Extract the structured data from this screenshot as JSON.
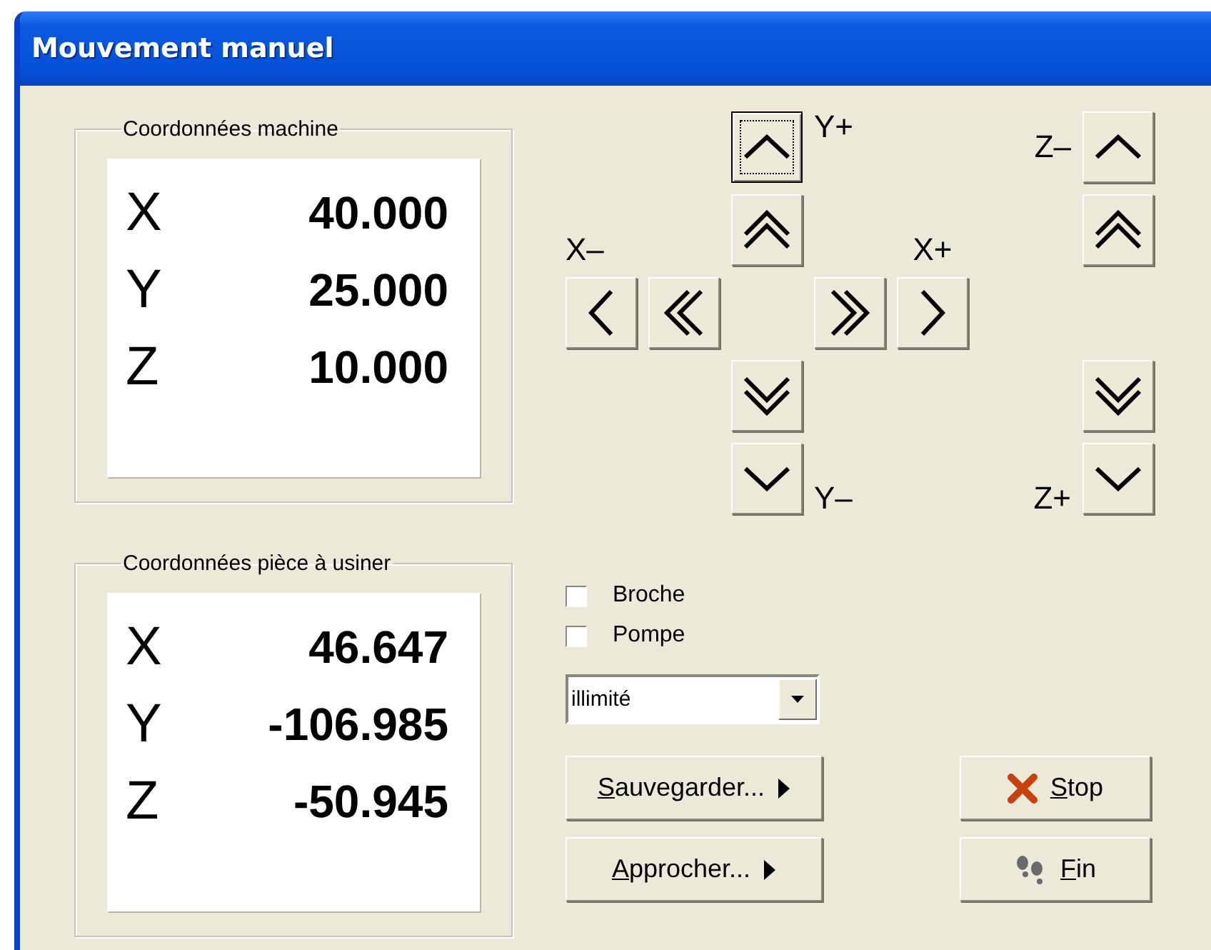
{
  "window": {
    "title": "Mouvement manuel"
  },
  "coordinate_groups": [
    {
      "label": "Coordonnées machine",
      "rows": [
        {
          "axis": "X",
          "value": "40.000"
        },
        {
          "axis": "Y",
          "value": "25.000"
        },
        {
          "axis": "Z",
          "value": "10.000"
        }
      ]
    },
    {
      "label": "Coordonnées pièce à usiner",
      "rows": [
        {
          "axis": "X",
          "value": "46.647"
        },
        {
          "axis": "Y",
          "value": "-106.985"
        },
        {
          "axis": "Z",
          "value": "-50.945"
        }
      ]
    }
  ],
  "jog": {
    "labels": [
      "Y+",
      "X–",
      "X+",
      "Y–",
      "Z–",
      "Z+"
    ],
    "buttons": [
      {
        "kind": "up",
        "focused": true
      },
      {
        "kind": "fast-up",
        "focused": false
      },
      {
        "kind": "left",
        "focused": false
      },
      {
        "kind": "fast-left",
        "focused": false
      },
      {
        "kind": "fast-right",
        "focused": false
      },
      {
        "kind": "right",
        "focused": false
      },
      {
        "kind": "fast-down",
        "focused": false
      },
      {
        "kind": "down",
        "focused": false
      },
      {
        "kind": "up",
        "focused": false
      },
      {
        "kind": "fast-up",
        "focused": false
      },
      {
        "kind": "fast-down",
        "focused": false
      },
      {
        "kind": "down",
        "focused": false
      }
    ]
  },
  "checkboxes": [
    {
      "label": "Broche",
      "checked": false
    },
    {
      "label": "Pompe",
      "checked": false
    }
  ],
  "dropdown": {
    "value": "illimité"
  },
  "action_buttons": [
    {
      "mnemonic": "S",
      "rest": "auvegarder...",
      "kind": "menu"
    },
    {
      "mnemonic": "A",
      "rest": "pprocher...",
      "kind": "menu"
    },
    {
      "mnemonic": "S",
      "rest": "top",
      "kind": "stop"
    },
    {
      "mnemonic": "F",
      "rest": "in",
      "kind": "finish"
    }
  ]
}
